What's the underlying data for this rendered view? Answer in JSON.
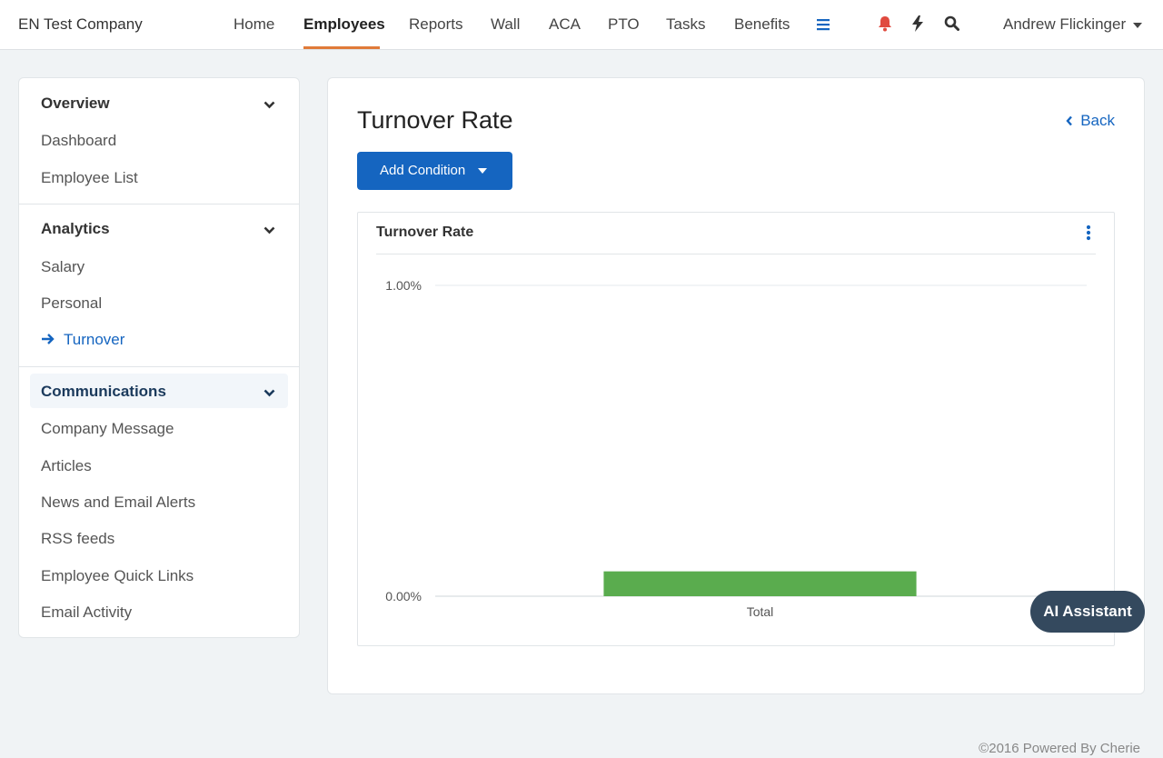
{
  "header": {
    "company": "EN Test Company",
    "nav": [
      {
        "label": "Home"
      },
      {
        "label": "Employees"
      },
      {
        "label": "Reports"
      },
      {
        "label": "Wall"
      },
      {
        "label": "ACA"
      },
      {
        "label": "PTO"
      },
      {
        "label": "Tasks"
      },
      {
        "label": "Benefits"
      }
    ],
    "active_nav": "Employees",
    "icons": [
      "menu-icon",
      "bell-icon",
      "bolt-icon",
      "search-icon"
    ],
    "user_name": "Andrew Flickinger"
  },
  "sidebar": {
    "sections": [
      {
        "title": "Overview",
        "items": [
          "Dashboard",
          "Employee List"
        ]
      },
      {
        "title": "Analytics",
        "items": [
          "Salary",
          "Personal",
          "Turnover"
        ],
        "active_item": "Turnover"
      },
      {
        "title": "Communications",
        "items": [
          "Company Message",
          "Articles",
          "News and Email Alerts",
          "RSS feeds",
          "Employee Quick Links",
          "Email Activity"
        ],
        "highlighted": true
      }
    ]
  },
  "main": {
    "title": "Turnover Rate",
    "back_label": "Back",
    "add_condition_label": "Add Condition",
    "chart_card_title": "Turnover Rate"
  },
  "chart_data": {
    "type": "bar",
    "categories": [
      "Total"
    ],
    "values": [
      0.08
    ],
    "ylim": [
      0,
      1
    ],
    "y_ticks": [
      "0.00%",
      "1.00%"
    ],
    "title": "",
    "xlabel": "",
    "ylabel": "",
    "bar_color": "#5aac4e",
    "grid": true
  },
  "ai_assistant_label": "AI Assistant",
  "footer": "©2016 Powered By Cherie",
  "colors": {
    "accent": "#1565c0",
    "nav_underline": "#e07b39",
    "bell": "#e04a3f",
    "ai_button": "#34495e"
  }
}
